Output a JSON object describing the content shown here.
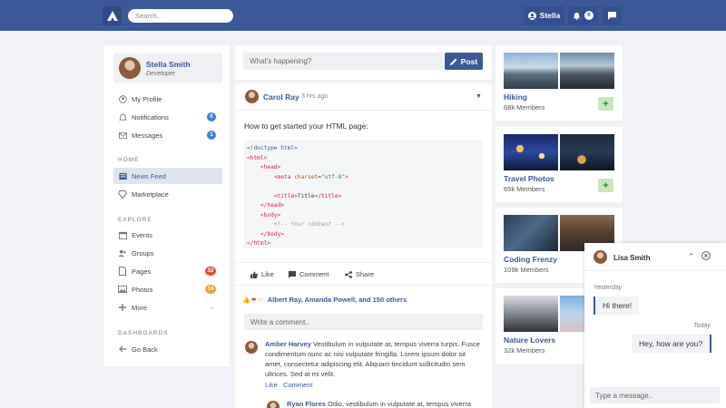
{
  "header": {
    "search_placeholder": "Search..",
    "user_label": "Stella",
    "notif_count": "6"
  },
  "sidebar": {
    "profile": {
      "name": "Stella Smith",
      "role": "Developer"
    },
    "items": [
      {
        "label": "My Profile"
      },
      {
        "label": "Notifications",
        "badge": "6"
      },
      {
        "label": "Messages",
        "badge": "1"
      }
    ],
    "home_title": "HOME",
    "home_items": [
      {
        "label": "News Feed"
      },
      {
        "label": "Marketplace"
      }
    ],
    "explore_title": "EXPLORE",
    "explore_items": [
      {
        "label": "Events"
      },
      {
        "label": "Groups"
      },
      {
        "label": "Pages",
        "badge": "32"
      },
      {
        "label": "Photos",
        "badge": "14"
      },
      {
        "label": "More"
      }
    ],
    "dash_title": "DASHBOARDS",
    "dash_items": [
      {
        "label": "Go Back"
      }
    ]
  },
  "composer": {
    "placeholder": "What's happening?",
    "post_label": "Post"
  },
  "post": {
    "author": "Carol Ray",
    "time": "3 hrs ago",
    "text": "How to get started your HTML page:",
    "actions": {
      "like": "Like",
      "comment": "Comment",
      "share": "Share"
    },
    "likes_text": "Albert Ray, Amanda Powell, and 150 others",
    "comment_placeholder": "Write a comment..",
    "comments": [
      {
        "name": "Amber Harvey",
        "lines": [
          "Vestibulum in vulputate at, tempus viverra turpis. Fusce",
          "condimentum nunc ac nisi vulputate fringilla. Lorem ipsum dolor sit",
          "amet, consectetur adipiscing elit. Aliquam tincidunt sollicitudin sem",
          "ultrices. Sed at mi velit."
        ],
        "like": "Like",
        "comment": "Comment"
      },
      {
        "name": "Ryan Flores",
        "text": "Odio, vestibulum in vulputate at, tempus viverra"
      }
    ]
  },
  "groups": [
    {
      "name": "Hiking",
      "members": "68k Members",
      "add": "+"
    },
    {
      "name": "Travel Photos",
      "members": "65k Members",
      "add": "+"
    },
    {
      "name": "Coding Frenzy",
      "members": "109k Members"
    },
    {
      "name": "Nature Lovers",
      "members": "32k Members"
    }
  ],
  "chat": {
    "name": "Lisa Smith",
    "day1": "Yesterday",
    "msg1": "Hi there!",
    "day2": "Today",
    "msg2": "Hey, how are you?",
    "input_placeholder": "Type a message.."
  },
  "colors": {
    "brand": "#3b5998",
    "badge_blue": "#3b82d6",
    "badge_red": "#e0523b",
    "badge_yellow": "#f0a53a"
  }
}
